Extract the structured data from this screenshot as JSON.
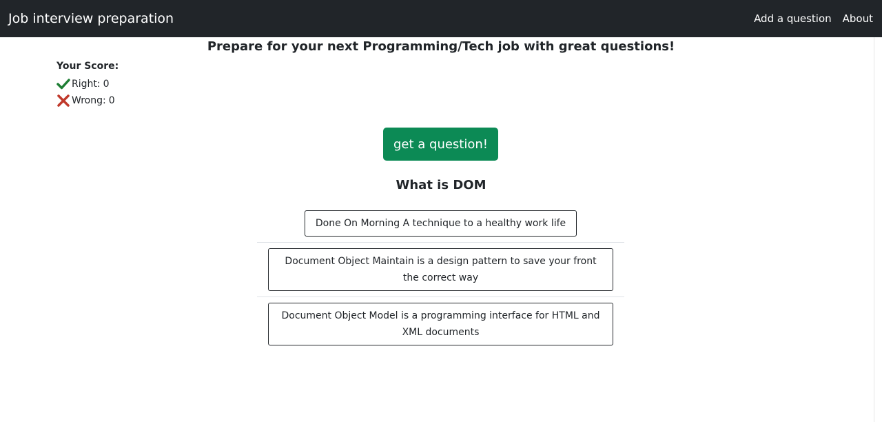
{
  "navbar": {
    "brand": "Job interview preparation",
    "links": [
      "Add a question",
      "About"
    ]
  },
  "headline": "Prepare for your next Programming/Tech job with great questions!",
  "score": {
    "title": "Your Score:",
    "right_label": "Right:",
    "right_value": "0",
    "wrong_label": "Wrong:",
    "wrong_value": "0"
  },
  "get_question_label": "get a question!",
  "question": "What is DOM",
  "answers": [
    "Done On Morning A technique to a healthy work life",
    "Document Object Maintain is a design pattern to save your front the correct way",
    "Document Object Model is a programming interface for HTML and XML documents"
  ],
  "colors": {
    "navbar_bg": "#212529",
    "primary_button": "#0c8a55",
    "check_icon": "#1e7e34",
    "cross_icon": "#c0392b"
  }
}
